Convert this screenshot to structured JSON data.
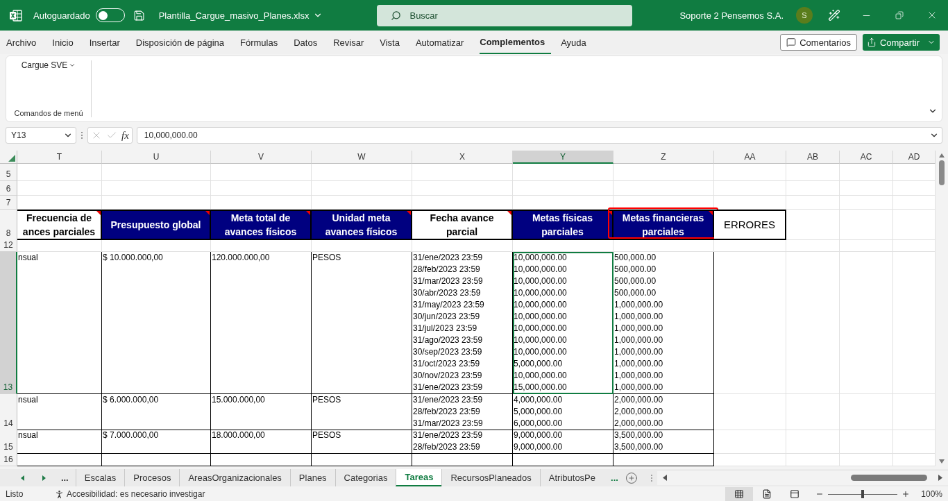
{
  "titlebar": {
    "autosave_label": "Autoguardado",
    "autosave_on": false,
    "filename": "Plantilla_Cargue_masivo_Planes.xlsx",
    "search_placeholder": "Buscar",
    "user": "Soporte 2 Pensemos S.A.",
    "avatar": "S"
  },
  "menu": [
    {
      "label": "Archivo",
      "selected": false
    },
    {
      "label": "Inicio",
      "selected": false
    },
    {
      "label": "Insertar",
      "selected": false
    },
    {
      "label": "Disposición de página",
      "selected": false
    },
    {
      "label": "Fórmulas",
      "selected": false
    },
    {
      "label": "Datos",
      "selected": false
    },
    {
      "label": "Revisar",
      "selected": false
    },
    {
      "label": "Vista",
      "selected": false
    },
    {
      "label": "Automatizar",
      "selected": false
    },
    {
      "label": "Complementos",
      "selected": true
    },
    {
      "label": "Ayuda",
      "selected": false
    }
  ],
  "comments_button": "Comentarios",
  "share_button": "Compartir",
  "ribbon": {
    "dropdown": "Cargue SVE",
    "group": "Comandos de menú"
  },
  "formula_bar": {
    "name_box": "Y13",
    "fx": "fx",
    "value": "10,000,000.00"
  },
  "columns": [
    {
      "label": "T",
      "selected": false
    },
    {
      "label": "U",
      "selected": false
    },
    {
      "label": "V",
      "selected": false
    },
    {
      "label": "W",
      "selected": false
    },
    {
      "label": "X",
      "selected": false
    },
    {
      "label": "Y",
      "selected": true
    },
    {
      "label": "Z",
      "selected": false
    },
    {
      "label": "AA",
      "selected": false
    },
    {
      "label": "AB",
      "selected": false
    },
    {
      "label": "AC",
      "selected": false
    },
    {
      "label": "AD",
      "selected": false
    }
  ],
  "rows": [
    {
      "number": "5",
      "kind": "blank",
      "selected": false
    },
    {
      "number": "6",
      "kind": "blank",
      "selected": false
    },
    {
      "number": "7",
      "kind": "blank",
      "selected": false
    },
    {
      "number": "8",
      "kind": "header",
      "selected": false,
      "cells": [
        {
          "lines": [
            "Frecuencia de",
            "ances parciales"
          ],
          "dark": false,
          "bold": true,
          "comment": true,
          "highlighted": false
        },
        {
          "lines": [
            "Presupuesto global"
          ],
          "dark": true,
          "bold": true,
          "comment": true,
          "highlighted": false
        },
        {
          "lines": [
            "Meta total de",
            "avances físicos"
          ],
          "dark": true,
          "bold": true,
          "comment": true,
          "highlighted": false
        },
        {
          "lines": [
            "Unidad meta",
            "avances físicos"
          ],
          "dark": true,
          "bold": true,
          "comment": true,
          "highlighted": false
        },
        {
          "lines": [
            "Fecha avance",
            "parcial"
          ],
          "dark": false,
          "bold": true,
          "comment": true,
          "highlighted": false
        },
        {
          "lines": [
            "Metas físicas",
            "parciales"
          ],
          "dark": true,
          "bold": true,
          "comment": true,
          "highlighted": false
        },
        {
          "lines": [
            "Metas financieras",
            "parciales"
          ],
          "dark": true,
          "bold": true,
          "comment": true,
          "highlighted": true
        },
        {
          "lines": [
            "ERRORES"
          ],
          "dark": false,
          "bold": false,
          "comment": false,
          "highlighted": false
        }
      ]
    },
    {
      "number": "12",
      "kind": "blank",
      "selected": false
    },
    {
      "number": "13",
      "kind": "data",
      "selected": true,
      "cells": [
        {
          "lines": [
            "nsual"
          ],
          "selected": false
        },
        {
          "lines": [
            "$ 10.000.000,00"
          ],
          "selected": false
        },
        {
          "lines": [
            "120.000.000,00"
          ],
          "selected": false
        },
        {
          "lines": [
            "PESOS"
          ],
          "selected": false
        },
        {
          "lines": [
            "31/ene/2023 23:59",
            "28/feb/2023 23:59",
            "31/mar/2023 23:59",
            "30/abr/2023 23:59",
            "31/may/2023 23:59",
            "30/jun/2023 23:59",
            "31/jul/2023 23:59",
            "31/ago/2023 23:59",
            "30/sep/2023 23:59",
            "31/oct/2023 23:59",
            "30/nov/2023 23:59",
            "31/ene/2023 23:59"
          ],
          "selected": false
        },
        {
          "lines": [
            "10,000,000.00",
            "10,000,000.00",
            "10,000,000.00",
            "10,000,000.00",
            "10,000,000.00",
            "10,000,000.00",
            "10,000,000.00",
            "10,000,000.00",
            "10,000,000.00",
            "5,000,000.00",
            "10,000,000.00",
            "15,000,000.00"
          ],
          "selected": true
        },
        {
          "lines": [
            "500,000.00",
            "500,000.00",
            "500,000.00",
            "500,000.00",
            "1,000,000.00",
            "1,000,000.00",
            "1,000,000.00",
            "1,000,000.00",
            "1,000,000.00",
            "1,000,000.00",
            "1,000,000.00",
            "1,000,000.00"
          ],
          "selected": false
        }
      ]
    },
    {
      "number": "14",
      "kind": "data",
      "selected": false,
      "cells": [
        {
          "lines": [
            "nsual"
          ],
          "selected": false
        },
        {
          "lines": [
            "$ 6.000.000,00"
          ],
          "selected": false
        },
        {
          "lines": [
            "15.000.000,00"
          ],
          "selected": false
        },
        {
          "lines": [
            "PESOS"
          ],
          "selected": false
        },
        {
          "lines": [
            "31/ene/2023 23:59",
            "28/feb/2023 23:59",
            "31/mar/2023 23:59"
          ],
          "selected": false
        },
        {
          "lines": [
            "4,000,000.00",
            "5,000,000.00",
            "6,000,000.00"
          ],
          "selected": false
        },
        {
          "lines": [
            "2,000,000.00",
            "2,000,000.00",
            "2,000,000.00"
          ],
          "selected": false
        }
      ]
    },
    {
      "number": "15",
      "kind": "data",
      "selected": false,
      "cells": [
        {
          "lines": [
            "nsual"
          ],
          "selected": false
        },
        {
          "lines": [
            "$ 7.000.000,00"
          ],
          "selected": false
        },
        {
          "lines": [
            "18.000.000,00"
          ],
          "selected": false
        },
        {
          "lines": [
            "PESOS"
          ],
          "selected": false
        },
        {
          "lines": [
            "31/ene/2023 23:59",
            "28/feb/2023 23:59"
          ],
          "selected": false
        },
        {
          "lines": [
            "9,000,000.00",
            "9,000,000.00"
          ],
          "selected": false
        },
        {
          "lines": [
            "3,500,000.00",
            "3,500,000.00"
          ],
          "selected": false
        }
      ]
    },
    {
      "number": "16",
      "kind": "data",
      "selected": false
    }
  ],
  "sheet_tabs": {
    "overflow_left": "...",
    "tabs": [
      {
        "label": "Escalas",
        "selected": false
      },
      {
        "label": "Procesos",
        "selected": false
      },
      {
        "label": "AreasOrganizacionales",
        "selected": false
      },
      {
        "label": "Planes",
        "selected": false
      },
      {
        "label": "Categorias",
        "selected": false
      },
      {
        "label": "Tareas",
        "selected": true
      },
      {
        "label": "RecursosPlaneados",
        "selected": false
      },
      {
        "label": "AtributosPe",
        "selected": false
      }
    ],
    "overflow_right": "..."
  },
  "status_bar": {
    "state": "Listo",
    "accessibility": "Accesibilidad: es necesario investigar",
    "zoom_slider": {
      "level": 0.5
    },
    "zoom": "100%"
  }
}
